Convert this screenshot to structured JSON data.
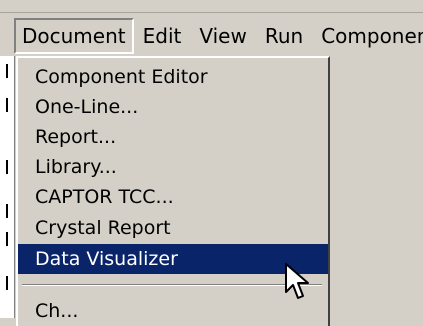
{
  "menubar": {
    "items": [
      {
        "label": "Document"
      },
      {
        "label": "Edit"
      },
      {
        "label": "View"
      },
      {
        "label": "Run"
      },
      {
        "label": "Componen"
      }
    ]
  },
  "dropdown": {
    "items": [
      {
        "label": "Component Editor"
      },
      {
        "label": "One-Line..."
      },
      {
        "label": "Report..."
      },
      {
        "label": "Library..."
      },
      {
        "label": "CAPTOR TCC..."
      },
      {
        "label": "Crystal Report"
      },
      {
        "label": "Data Visualizer"
      },
      {
        "label": "Ch..."
      }
    ]
  },
  "colors": {
    "menu_bg": "#d4d0c8",
    "highlight_bg": "#0a246a",
    "highlight_text": "#ffffff"
  },
  "icons": {
    "cursor": "arrow-cursor-icon"
  }
}
